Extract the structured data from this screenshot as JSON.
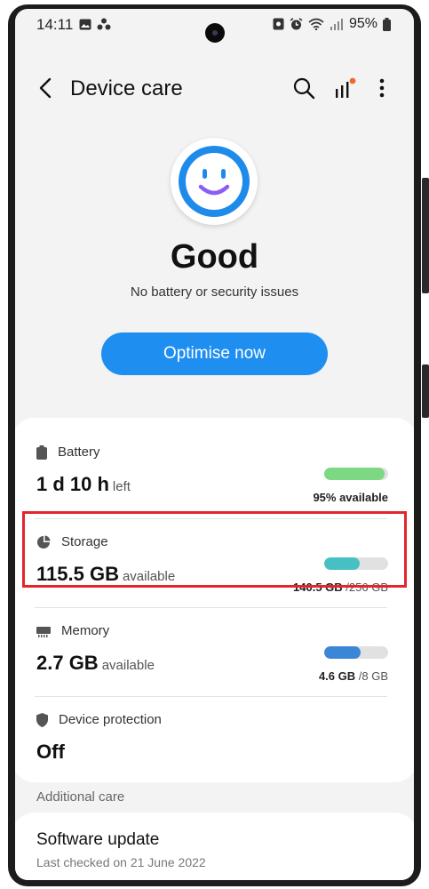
{
  "status_bar": {
    "time": "14:11",
    "battery": "95%"
  },
  "app_bar": {
    "title": "Device care"
  },
  "hero": {
    "status": "Good",
    "subtitle": "No battery or security issues",
    "button_label": "Optimise now"
  },
  "rows": {
    "battery": {
      "label": "Battery",
      "main_value": "1 d 10 h",
      "main_suffix": "left",
      "right_value": "95% available",
      "fill_percent": 95,
      "color": "#7cd883"
    },
    "storage": {
      "label": "Storage",
      "main_value": "115.5 GB",
      "main_suffix": "available",
      "right_used": "140.5 GB",
      "right_total": "/256 GB",
      "fill_percent": 55,
      "color": "#47c0c4"
    },
    "memory": {
      "label": "Memory",
      "main_value": "2.7 GB",
      "main_suffix": "available",
      "right_used": "4.6 GB",
      "right_total": "/8 GB",
      "fill_percent": 57,
      "color": "#3b86d6"
    },
    "protection": {
      "label": "Device protection",
      "main_value": "Off"
    }
  },
  "additional": {
    "section_title": "Additional care",
    "software_update_title": "Software update",
    "software_update_sub": "Last checked on 21 June 2022"
  },
  "colors": {
    "accent": "#1f8ef1",
    "highlight": "#e3262d"
  }
}
